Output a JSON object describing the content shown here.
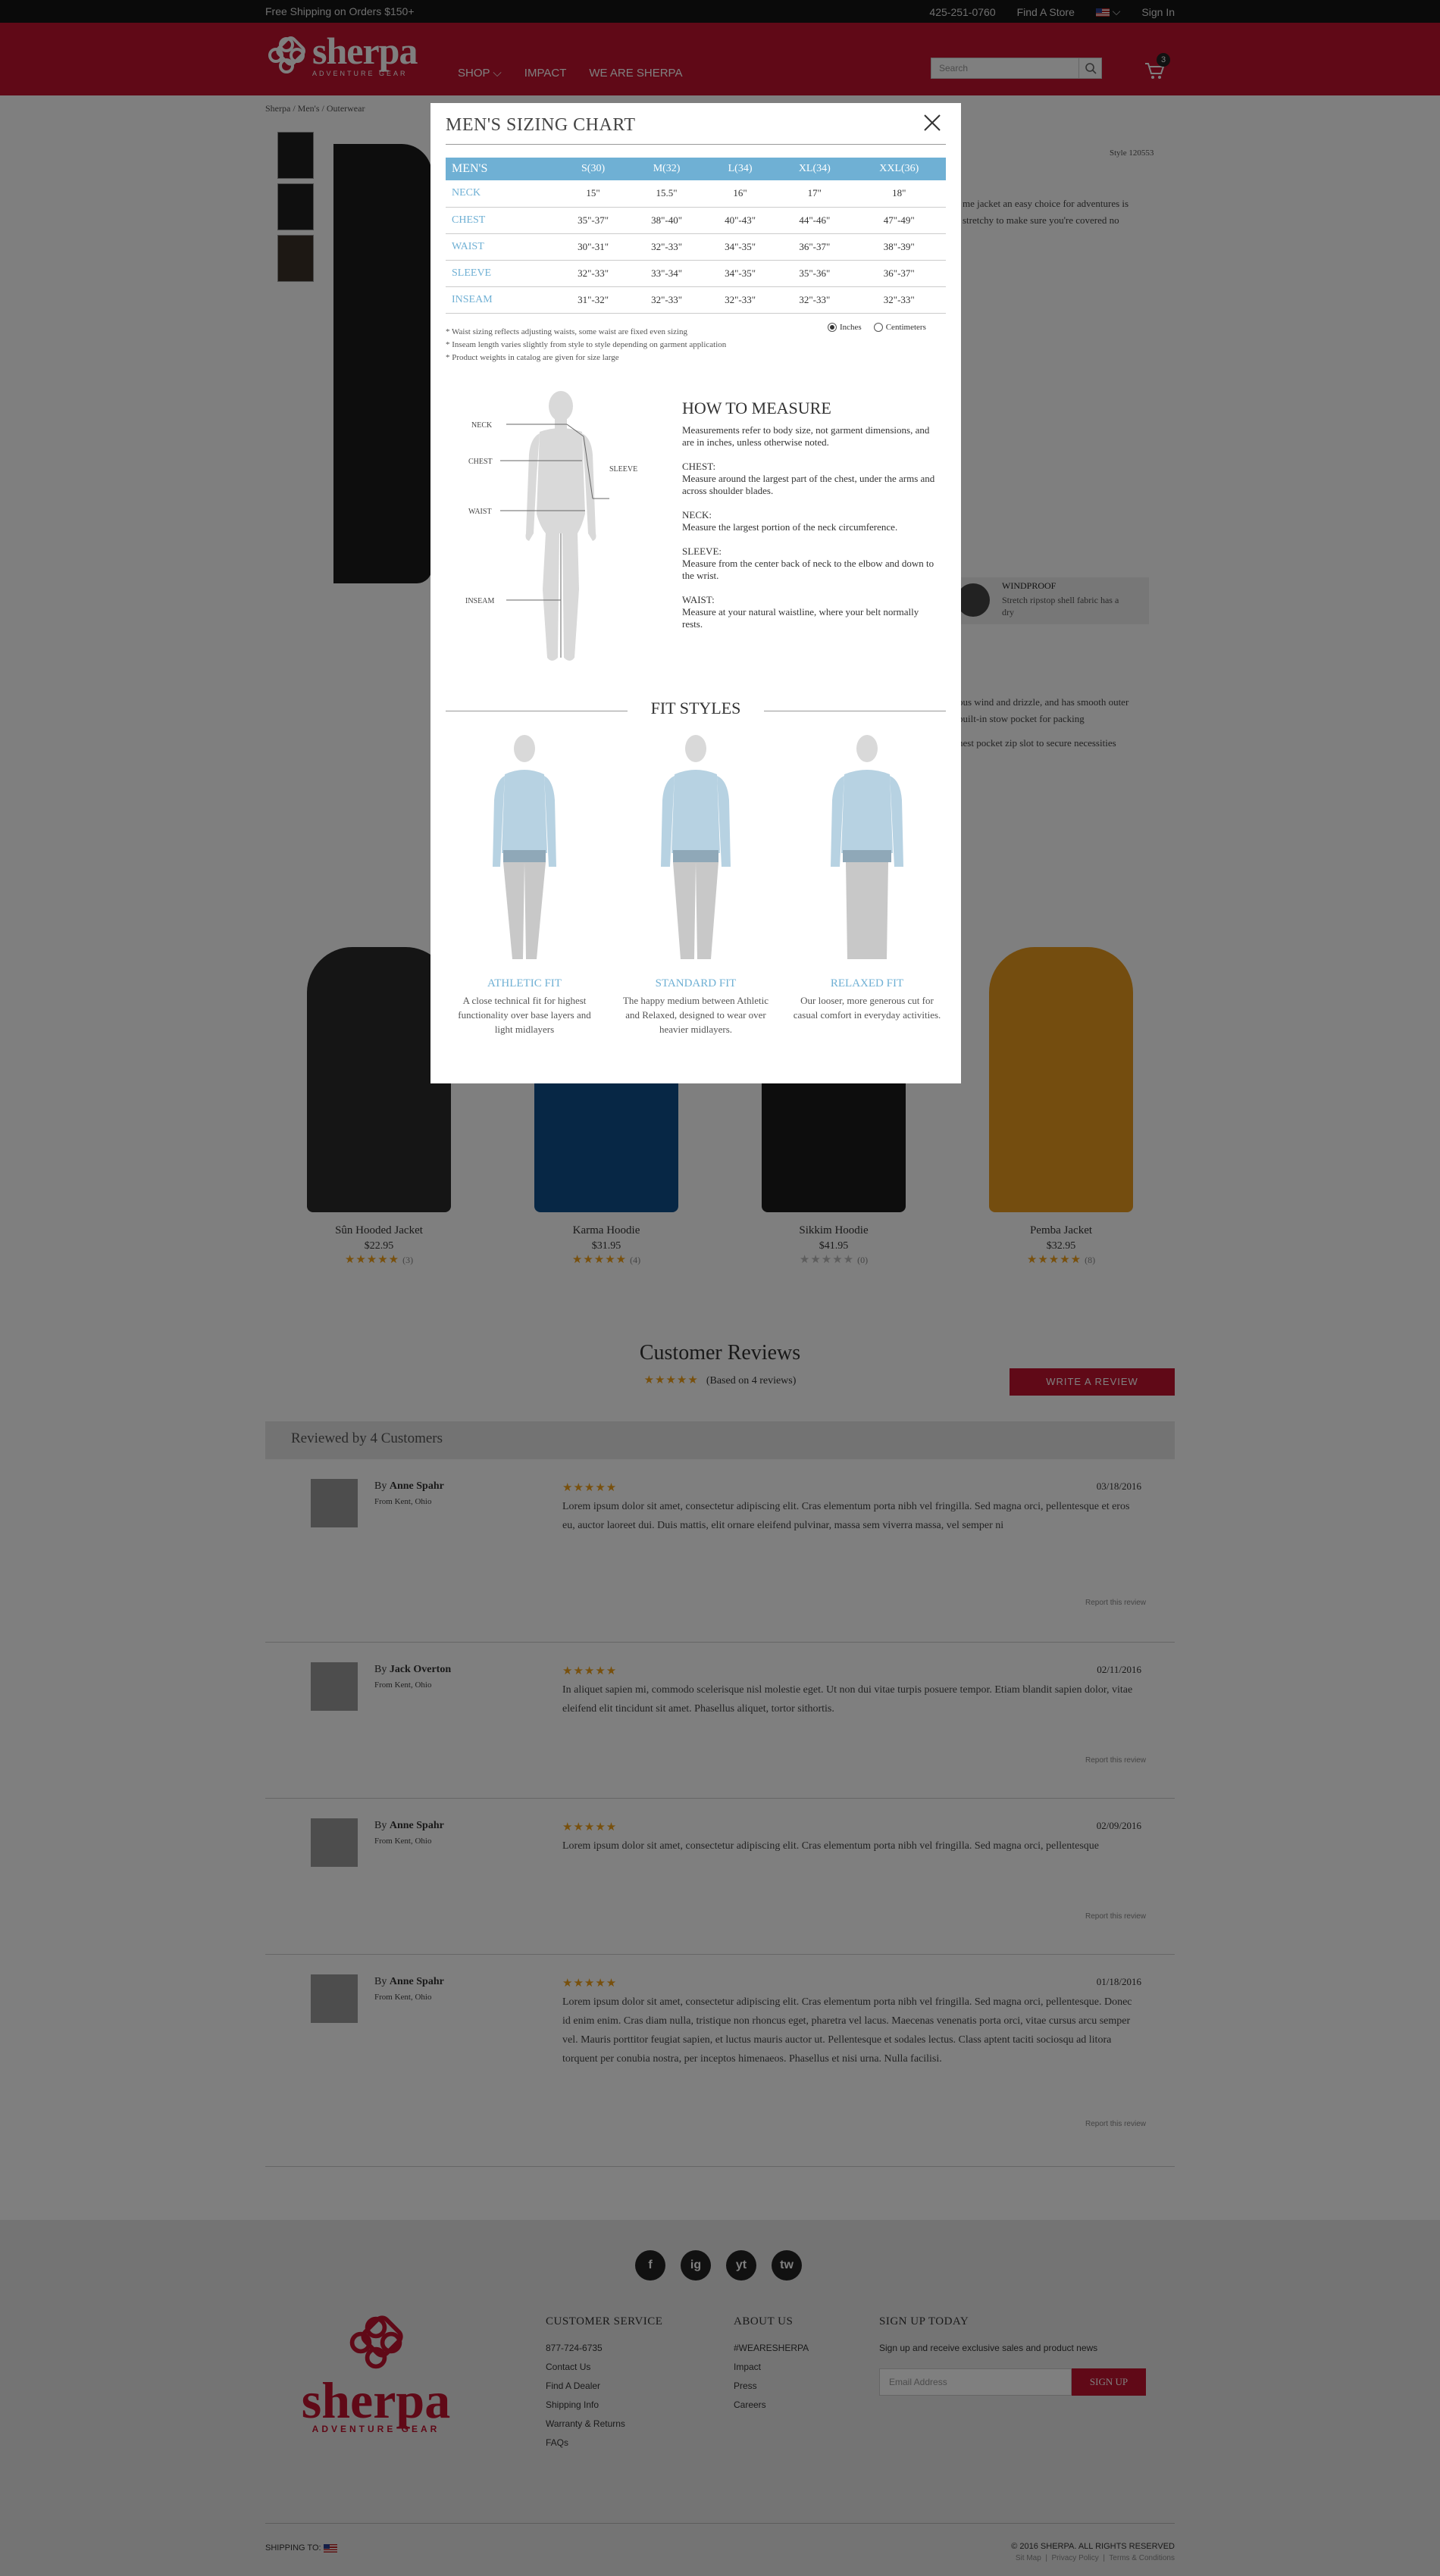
{
  "topbar": {
    "promo": "Free Shipping on Orders $150+",
    "phone": "425-251-0760",
    "find_store": "Find A Store",
    "sign_in": "Sign In"
  },
  "header": {
    "logo_word": "sherpa",
    "logo_tag": "ADVENTURE GEAR",
    "nav": [
      "SHOP",
      "IMPACT",
      "WE ARE SHERPA"
    ],
    "search_placeholder": "Search",
    "cart_count": "3"
  },
  "breadcrumb": "Sherpa /  Men's  /  Outerwear",
  "product": {
    "style": "Style 120553",
    "description_lines": [
      "me jacket an easy choice for adventures is",
      "stretchy to make sure you're covered no"
    ],
    "feature": {
      "title": "WINDPROOF",
      "text": "Stretch ripstop shell fabric has a dry"
    },
    "bullets": [
      "ous wind and drizzle, and has smooth outer",
      "built-in stow pocket for packing",
      "hest pocket zip slot to secure necessities"
    ]
  },
  "modal": {
    "title": "MEN'S SIZING CHART",
    "table": {
      "headers": [
        "MEN'S",
        "S(30)",
        "M(32)",
        "L(34)",
        "XL(34)",
        "XXL(36)"
      ],
      "rows": [
        [
          "NECK",
          "15\"",
          "15.5\"",
          "16\"",
          "17\"",
          "18\""
        ],
        [
          "CHEST",
          "35\"-37\"",
          "38\"-40\"",
          "40\"-43\"",
          "44\"-46\"",
          "47\"-49\""
        ],
        [
          "WAIST",
          "30\"-31\"",
          "32\"-33\"",
          "34\"-35\"",
          "36\"-37\"",
          "38\"-39\""
        ],
        [
          "SLEEVE",
          "32\"-33\"",
          "33\"-34\"",
          "34\"-35\"",
          "35\"-36\"",
          "36\"-37\""
        ],
        [
          "INSEAM",
          "31\"-32\"",
          "32\"-33\"",
          "32\"-33\"",
          "32\"-33\"",
          "32\"-33\""
        ]
      ]
    },
    "notes": [
      "* Waist sizing reflects adjusting waists, some waist are fixed even sizing",
      "* Inseam length varies slightly from style to style depending on garment application",
      "* Product weights in catalog are given for size large"
    ],
    "units": {
      "inches": "Inches",
      "centimeters": "Centimeters",
      "selected": "inches"
    },
    "figure_labels": {
      "neck": "NECK",
      "sleeve": "SLEEVE",
      "chest": "CHEST",
      "waist": "WAIST",
      "inseam": "INSEAM"
    },
    "how_to_measure": {
      "title": "HOW TO MEASURE",
      "intro": "Measurements refer to body size, not garment dimensions, and are in inches, unless otherwise noted.",
      "items": [
        {
          "term": "CHEST:",
          "text": "Measure around the largest part of the chest, under the arms and across shoulder blades."
        },
        {
          "term": "NECK:",
          "text": "Measure the largest portion of the neck circumference."
        },
        {
          "term": "SLEEVE:",
          "text": "Measure from the center back of neck to the elbow and down to the wrist."
        },
        {
          "term": "WAIST:",
          "text": "Measure at your natural waistline, where your belt normally rests."
        }
      ]
    },
    "fit_styles": {
      "title": "FIT STYLES",
      "items": [
        {
          "name": "ATHLETIC FIT",
          "desc": "A close technical fit for highest functionality over base layers and light midlayers"
        },
        {
          "name": "STANDARD FIT",
          "desc": "The happy medium between Athletic and Relaxed, designed to wear over heavier midlayers."
        },
        {
          "name": "RELAXED FIT",
          "desc": "Our looser, more generous cut for casual comfort in everyday activities."
        }
      ]
    }
  },
  "related": [
    {
      "name": "Sûn Hooded Jacket",
      "price": "$22.95",
      "rating": 5,
      "count": "(3)",
      "color": "#2a2a2a"
    },
    {
      "name": "Karma Hoodie",
      "price": "$31.95",
      "rating": 5,
      "count": "(4)",
      "color": "#0f4f8a"
    },
    {
      "name": "Sikkim Hoodie",
      "price": "$41.95",
      "rating": 0,
      "count": "(0)",
      "color": "#1a1a1a"
    },
    {
      "name": "Pemba Jacket",
      "price": "$32.95",
      "rating": 5,
      "count": "(8)",
      "color": "#e89a1e"
    }
  ],
  "reviews_section": {
    "title": "Customer Reviews",
    "stars": "★★★★★",
    "based_on": "(Based on 4 reviews)",
    "write_button": "WRITE A REVIEW",
    "band": "Reviewed by 4 Customers"
  },
  "reviews": [
    {
      "by": "By ",
      "name": "Anne Spahr",
      "from": "From Kent, Ohio",
      "stars": "★★★★★",
      "date": "03/18/2016",
      "text": "Lorem ipsum dolor sit amet, consectetur adipiscing elit. Cras elementum porta nibh vel fringilla. Sed magna orci, pellentesque et eros eu, auctor laoreet dui. Duis mattis, elit ornare eleifend pulvinar, massa sem viverra massa, vel semper ni",
      "report": "Report this review"
    },
    {
      "by": "By ",
      "name": "Jack Overton",
      "from": "From Kent, Ohio",
      "stars": "★★★★★",
      "date": "02/11/2016",
      "text": "In aliquet sapien mi, commodo scelerisque nisl molestie eget. Ut non dui vitae turpis posuere tempor. Etiam blandit sapien dolor, vitae eleifend elit tincidunt sit amet. Phasellus aliquet, tortor sithortis.",
      "report": "Report this review"
    },
    {
      "by": "By ",
      "name": "Anne Spahr",
      "from": "From Kent, Ohio",
      "stars": "★★★★★",
      "date": "02/09/2016",
      "text": "Lorem ipsum dolor sit amet, consectetur adipiscing elit. Cras elementum porta nibh vel fringilla. Sed magna orci, pellentesque",
      "report": "Report this review"
    },
    {
      "by": "By ",
      "name": "Anne Spahr",
      "from": "From Kent, Ohio",
      "stars": "★★★★★",
      "date": "01/18/2016",
      "text": "Lorem ipsum dolor sit amet, consectetur adipiscing elit. Cras elementum porta nibh vel fringilla. Sed magna orci, pellentesque. Donec id enim enim. Cras diam nulla, tristique non rhoncus eget, pharetra vel lacus. Maecenas venenatis porta orci, vitae cursus arcu semper vel. Mauris porttitor feugiat sapien, et luctus mauris auctor ut. Pellentesque et sodales lectus. Class aptent taciti sociosqu ad litora torquent per conubia nostra, per inceptos himenaeos. Phasellus et nisi urna. Nulla facilisi.",
      "report": "Report this review"
    }
  ],
  "footer": {
    "social": [
      "f",
      "ig",
      "yt",
      "tw"
    ],
    "logo_word": "sherpa",
    "logo_tag": "ADVENTURE GEAR",
    "customer_service": {
      "title": "CUSTOMER SERVICE",
      "links": [
        "877-724-6735",
        "Contact Us",
        "Find A Dealer",
        "Shipping Info",
        "Warranty & Returns",
        "FAQs"
      ]
    },
    "about": {
      "title": "ABOUT US",
      "links": [
        "#WEARESHERPA",
        "Impact",
        "Press",
        "Careers"
      ]
    },
    "signup": {
      "title": "SIGN UP TODAY",
      "text": "Sign up and receive exclusive sales and product news",
      "placeholder": "Email Address",
      "button": "SIGN UP"
    },
    "shipping_to": "SHIPPING TO:",
    "copyright": "© 2016 SHERPA. ALL RIGHTS RESERVED",
    "bottom_links": [
      "Sit Map",
      "Privacy Policy",
      "Terms & Conditions"
    ]
  },
  "colors": {
    "brand_red": "#c0132e",
    "accent_blue": "#6fb0d4",
    "star": "#f0a01a"
  }
}
